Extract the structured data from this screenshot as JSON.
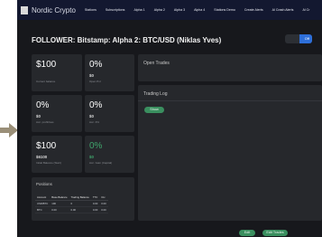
{
  "navbar": {
    "logo_text": "Nordic Crypto",
    "items": [
      "Stations",
      "Subscriptions",
      "Alpha 1",
      "Alpha 2",
      "Alpha 3",
      "Alpha 4",
      "Stations Demo",
      "Create Alerts",
      "Al Crash Alerts",
      "Al Cr"
    ]
  },
  "page": {
    "title": "FOLLOWER: Bitstamp: Alpha 2: BTC/USD (Niklas Yves)",
    "toggle_label": "Off"
  },
  "stats": {
    "balance": {
      "big": "$100",
      "label": "Current balance"
    },
    "profit_pct": {
      "big": "0%",
      "small": "$0",
      "label": "Open Pnl"
    },
    "pct_2": {
      "big": "0%",
      "small": "$0",
      "label": "Acc. profit/loss"
    },
    "pct_3": {
      "big": "0%",
      "small": "$0",
      "label": "Acc. Pnl"
    },
    "start_balance": {
      "big": "$100",
      "small": "$6100",
      "label": "Initial Balance (Start)"
    },
    "gain": {
      "big": "0%",
      "small": "$0",
      "label": "Acc. Gain (Capital)"
    }
  },
  "panels": {
    "open_trades_title": "Open Trades",
    "trading_log_title": "Trading Log",
    "trading_log_button": "Show"
  },
  "positions": {
    "title": "Positions",
    "columns": [
      "Account",
      "Base Balance",
      "Trading Balance",
      "TTC",
      "Ctx"
    ],
    "rows": [
      [
        "USD/BTC",
        "100",
        "0",
        "0.00",
        "0.00"
      ],
      [
        "BTC",
        "0.00",
        "0.00",
        "0.00",
        "0.00"
      ]
    ]
  },
  "footer_buttons": {
    "edit": "Edit",
    "edit_trades": "Edit Trades"
  },
  "colors": {
    "accent_green": "#3a8f5f",
    "navbar_bg": "#131830",
    "toggle_blue": "#2e6fd9"
  }
}
